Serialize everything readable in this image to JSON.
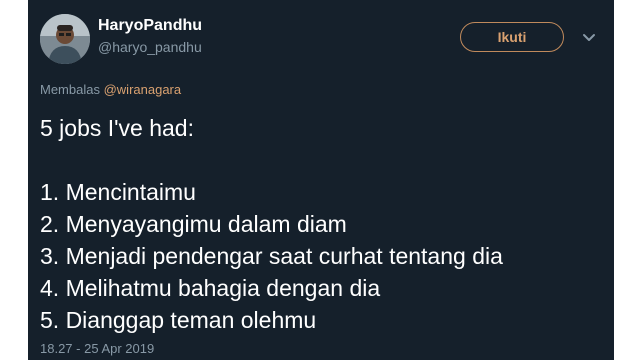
{
  "author": {
    "display_name": "HaryoPandhu",
    "handle": "@haryo_pandhu"
  },
  "follow_button": {
    "label": "Ikuti"
  },
  "reply": {
    "prefix": "Membalas",
    "mention": "@wiranagara"
  },
  "tweet": {
    "intro": "5 jobs I've had:",
    "items": [
      "1. Mencintaimu",
      "2. Menyayangimu dalam diam",
      "3. Menjadi pendengar saat curhat tentang dia",
      "4. Melihatmu bahagia dengan dia",
      "5. Dianggap teman olehmu"
    ]
  },
  "timestamp": "18.27 - 25 Apr 2019",
  "icons": {
    "avatar": "avatar-photo",
    "menu": "chevron-down-icon"
  },
  "colors": {
    "background": "#15202b",
    "accent": "#d9a170",
    "secondary_text": "#8899a6"
  }
}
